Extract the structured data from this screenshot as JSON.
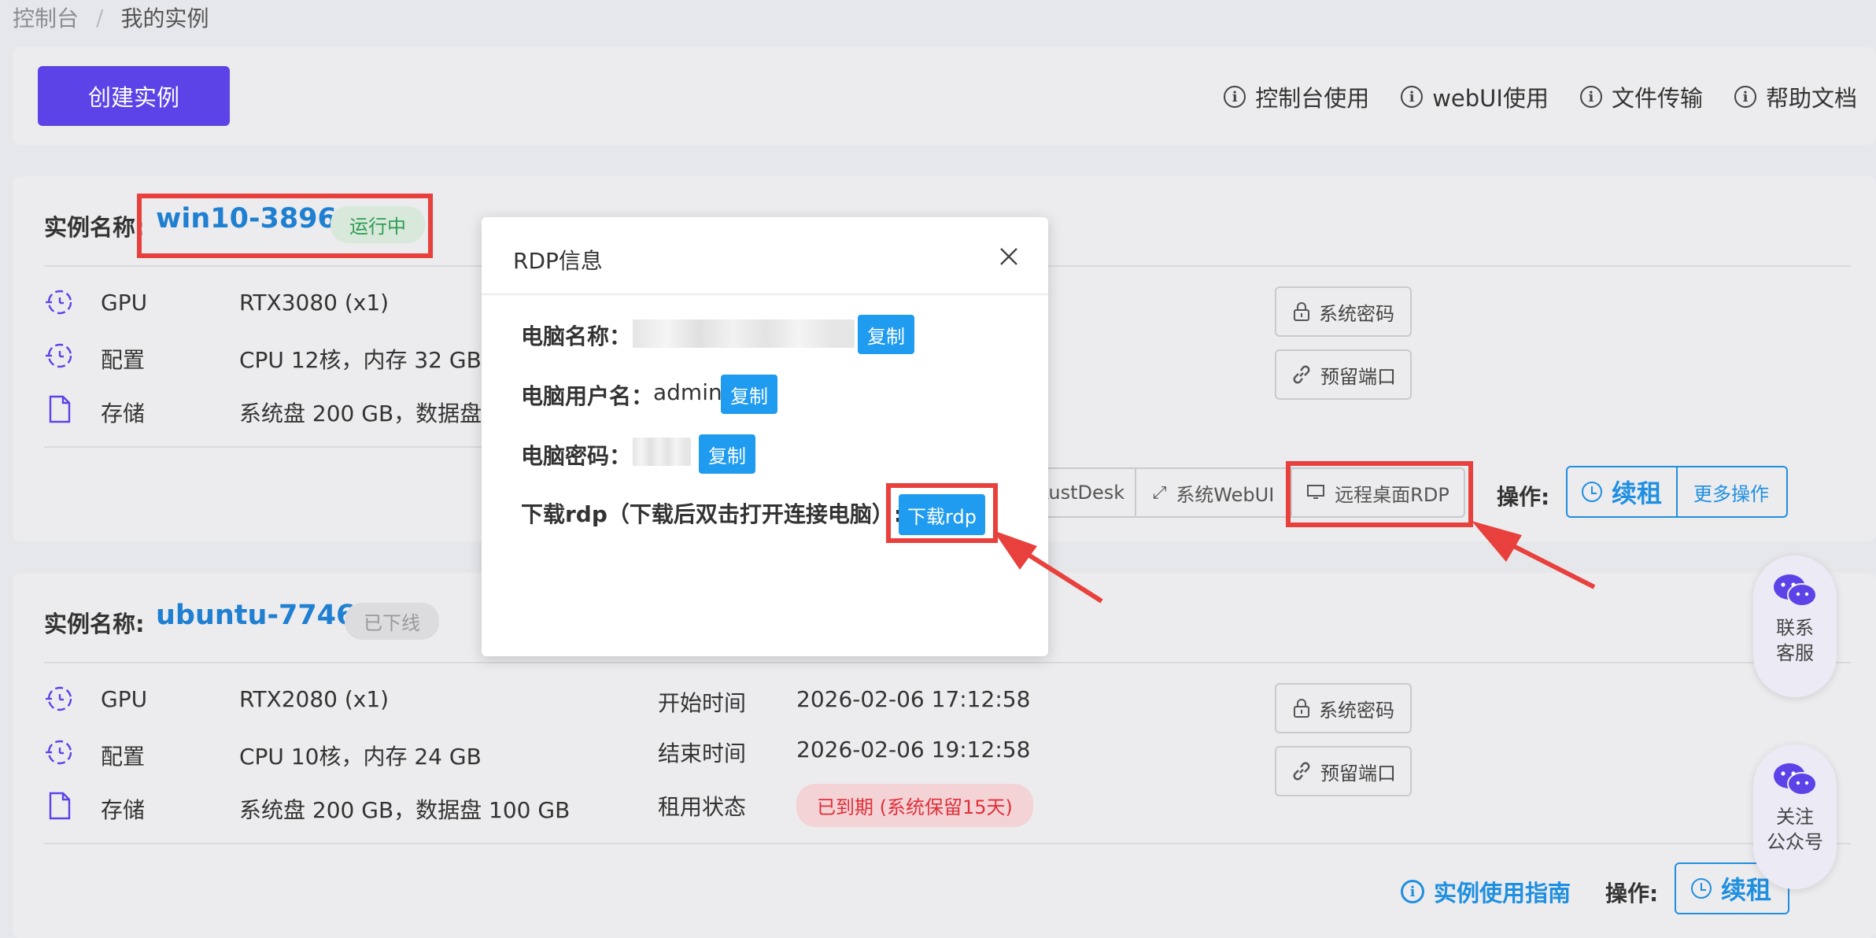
{
  "breadcrumb": {
    "root": "控制台",
    "separator": "/",
    "current": "我的实例"
  },
  "toolbar": {
    "create_button": "创建实例",
    "help_links": [
      "控制台使用",
      "webUI使用",
      "文件传输",
      "帮助文档"
    ]
  },
  "instances": [
    {
      "name_label": "实例名称:",
      "name": "win10-3896",
      "status": "运行中",
      "specs": [
        {
          "label": "GPU",
          "value": "RTX3080 (x1)"
        },
        {
          "label": "配置",
          "value": "CPU 12核，内存 32 GB"
        },
        {
          "label": "存储",
          "value": "系统盘 200 GB，数据盘"
        }
      ],
      "side_buttons": [
        "系统密码",
        "预留端口"
      ],
      "action_buttons": [
        "RustDesk",
        "系统WebUI",
        "远程桌面RDP"
      ],
      "ops_label": "操作:",
      "renew": "续租",
      "more": "更多操作"
    },
    {
      "name_label": "实例名称:",
      "name": "ubuntu-7746",
      "status": "已下线",
      "specs": [
        {
          "label": "GPU",
          "value": "RTX2080 (x1)"
        },
        {
          "label": "配置",
          "value": "CPU 10核，内存 24 GB"
        },
        {
          "label": "存储",
          "value": "系统盘 200 GB，数据盘 100 GB"
        }
      ],
      "times": [
        {
          "label": "开始时间",
          "value": "2026-02-06 17:12:58"
        },
        {
          "label": "结束时间",
          "value": "2026-02-06 19:12:58"
        },
        {
          "label": "租用状态",
          "value": "已到期 (系统保留15天)"
        }
      ],
      "side_buttons": [
        "系统密码",
        "预留端口"
      ],
      "guide": "实例使用指南",
      "ops_label": "操作:",
      "renew": "续租"
    }
  ],
  "modal": {
    "title": "RDP信息",
    "computer_name_label": "电脑名称：",
    "username_label": "电脑用户名：",
    "username": "admin",
    "password_label": "电脑密码：",
    "download_label": "下载rdp（下载后双击打开连接电脑）:",
    "copy": "复制",
    "download_button": "下载rdp"
  },
  "floating": [
    {
      "line1": "联系",
      "line2": "客服"
    },
    {
      "line1": "关注",
      "line2": "公众号"
    }
  ],
  "colors": {
    "primary": "#5b43e8",
    "link": "#1f7fd1",
    "accent": "#1f9bf0",
    "annotation": "#e8403c"
  }
}
